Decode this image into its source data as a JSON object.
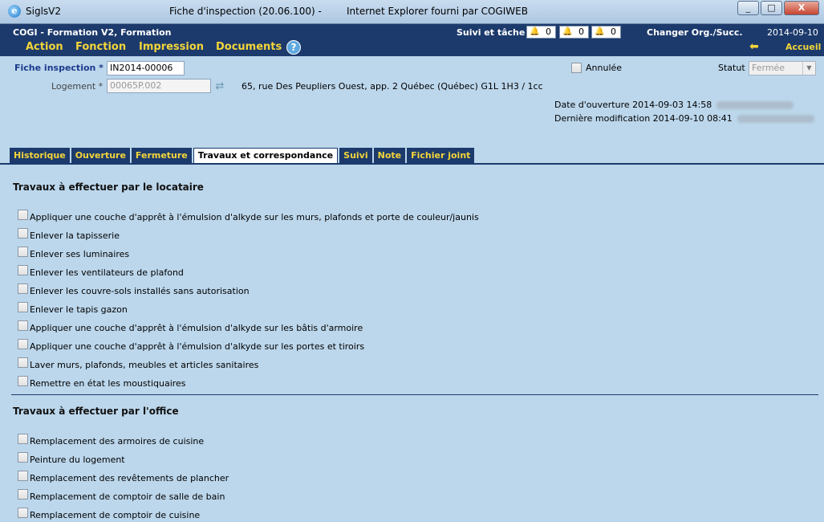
{
  "window": {
    "app_name": "SiglsV2",
    "page_title": "Fiche d'inspection (20.06.100) -",
    "browser_title": "Internet Explorer fourni par COGIWEB",
    "controls": [
      "_",
      "□",
      "X"
    ]
  },
  "header": {
    "org": "COGI - Formation V2, Formation",
    "menu": [
      "Action",
      "Fonction",
      "Impression",
      "Documents"
    ],
    "help_icon": "?",
    "suivi_label": "Suivi et tâche",
    "counters": [
      {
        "icon": "red-bell-icon",
        "color": "#d9262b",
        "value": "0"
      },
      {
        "icon": "orange-bell-icon",
        "color": "#e2a21b",
        "value": "0"
      },
      {
        "icon": "green-bell-icon",
        "color": "#2aa33a",
        "value": "0"
      }
    ],
    "change_org": "Changer Org./Succ.",
    "date": "2014-09-10",
    "accueil": "Accueil"
  },
  "form": {
    "fiche_label": "Fiche inspection *",
    "fiche_value": "IN2014-00006",
    "logement_label": "Logement *",
    "logement_value": "00065P.002",
    "address": "65, rue Des Peupliers Ouest, app. 2 Québec (Québec) G1L 1H3 / 1cc",
    "annulee_label": "Annulée",
    "statut_label": "Statut",
    "statut_value": "Fermée",
    "date_ouverture": "Date d'ouverture 2014-09-03 14:58",
    "derniere_modif": "Dernière modification 2014-09-10 08:41"
  },
  "tabs": [
    {
      "label": "Historique",
      "active": false
    },
    {
      "label": "Ouverture",
      "active": false
    },
    {
      "label": "Fermeture",
      "active": false
    },
    {
      "label": "Travaux et correspondance",
      "active": true
    },
    {
      "label": "Suivi",
      "active": false
    },
    {
      "label": "Note",
      "active": false
    },
    {
      "label": "Fichier joint",
      "active": false
    }
  ],
  "locataire": {
    "title": "Travaux à effectuer par le locataire",
    "items": [
      "Appliquer une couche d'apprêt à l'émulsion d'alkyde sur les murs, plafonds et porte de couleur/jaunis",
      "Enlever la tapisserie",
      "Enlever ses luminaires",
      "Enlever les ventilateurs de plafond",
      "Enlever les couvre-sols installés sans autorisation",
      "Enlever le tapis gazon",
      "Appliquer une couche d'apprêt à l'émulsion d'alkyde sur les bâtis d'armoire",
      "Appliquer une couche d'apprêt à l'émulsion d'alkyde sur les portes et tiroirs",
      "Laver murs, plafonds, meubles et articles sanitaires",
      "Remettre en état les moustiquaires"
    ]
  },
  "office": {
    "title": "Travaux à effectuer par l'office",
    "items": [
      "Remplacement des armoires de cuisine",
      "Peinture du logement",
      "Remplacement des revêtements de plancher",
      "Remplacement de comptoir de salle de bain",
      "Remplacement de comptoir de cuisine"
    ]
  }
}
